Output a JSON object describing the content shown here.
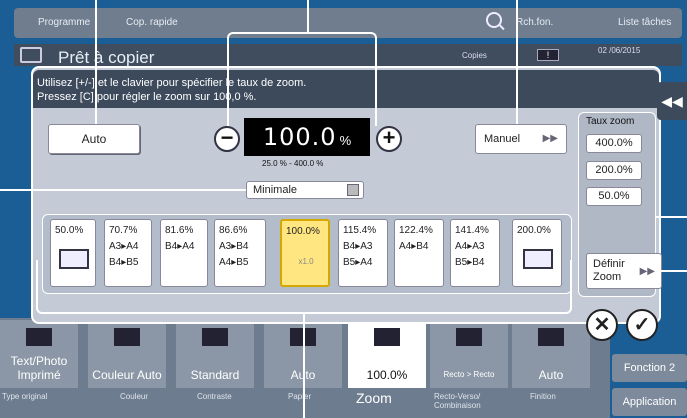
{
  "header": {
    "programme": "Programme",
    "cop_rapide": "Cop. rapide",
    "rch_fon": "Rch.fon.",
    "liste_taches": "Liste tâches",
    "status": "Prêt à copier",
    "copies_label": "Copies",
    "date": "02 /06/2015"
  },
  "dialog": {
    "instruction_line1": "Utilisez [+/-] et le clavier pour spécifier le taux de zoom.",
    "instruction_line2": "Pressez [C] pour régler le zoom sur 100,0 %.",
    "auto_label": "Auto",
    "zoom_value": "100.0",
    "zoom_unit": "%",
    "zoom_range": "25.0 % - 400.0 %",
    "minimale_label": "Minimale",
    "manuel_label": "Manuel",
    "minus": "−",
    "plus": "+"
  },
  "taux_zoom": {
    "title": "Taux zoom",
    "presets": [
      "400.0%",
      "200.0%",
      "50.0%"
    ],
    "definir_line1": "Définir",
    "definir_line2": "Zoom"
  },
  "ratios": [
    {
      "pct": "50.0%",
      "l1": "",
      "l2": ""
    },
    {
      "pct": "70.7%",
      "l1": "A3▸A4",
      "l2": "B4▸B5"
    },
    {
      "pct": "81.6%",
      "l1": "B4▸A4",
      "l2": ""
    },
    {
      "pct": "86.6%",
      "l1": "A3▸B4",
      "l2": "A4▸B5"
    },
    {
      "pct": "100.0%",
      "l1": "",
      "l2": "",
      "x1": "x1.0"
    },
    {
      "pct": "115.4%",
      "l1": "B4▸A3",
      "l2": "B5▸A4"
    },
    {
      "pct": "122.4%",
      "l1": "A4▸B4",
      "l2": ""
    },
    {
      "pct": "141.4%",
      "l1": "A4▸A3",
      "l2": "B5▸B4"
    },
    {
      "pct": "200.0%",
      "l1": "",
      "l2": ""
    }
  ],
  "actions": {
    "close": "✕",
    "ok": "✓",
    "collapse": "◀◀"
  },
  "function_bar": {
    "tiles": [
      {
        "value": "Text/Photo Imprimé",
        "label": "Type original"
      },
      {
        "value": "Couleur Auto",
        "label": "Couleur"
      },
      {
        "value": "Standard",
        "label": "Contraste"
      },
      {
        "value": "Auto",
        "label": "Papier"
      },
      {
        "value": "100.0%",
        "label": "Zoom"
      },
      {
        "value": "Recto > Recto",
        "label": "Recto-Verso/ Combinaison"
      },
      {
        "value": "Auto",
        "label": "Finition"
      }
    ],
    "fonction2": "Fonction 2",
    "application": "Application"
  },
  "colors": {
    "background": "#1b5e96",
    "selected": "#ffe680",
    "display": "#000000"
  }
}
